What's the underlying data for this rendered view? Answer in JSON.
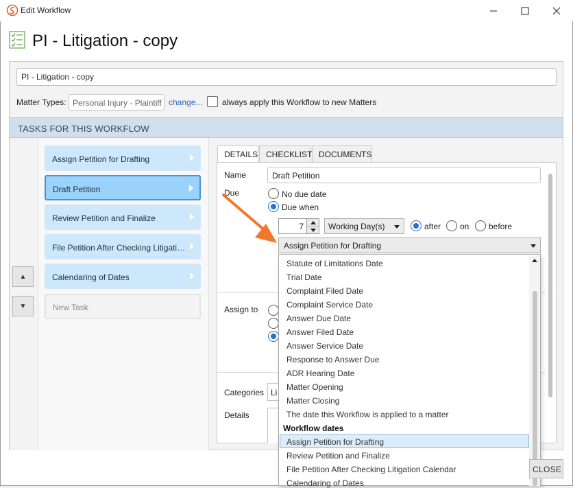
{
  "window": {
    "title": "Edit Workflow"
  },
  "header": {
    "title": "PI - Litigation - copy"
  },
  "form": {
    "workflow_name": "PI - Litigation - copy",
    "matter_types_label": "Matter Types:",
    "matter_types_value": "Personal Injury - Plaintiff",
    "change_link": "change...",
    "always_apply_label": "always apply this Workflow to new Matters"
  },
  "tasks_section": {
    "header": "TASKS FOR THIS WORKFLOW",
    "tasks": [
      {
        "label": "Assign Petition for Drafting"
      },
      {
        "label": "Draft Petition"
      },
      {
        "label": "Review Petition and Finalize"
      },
      {
        "label": "File Petition After Checking Litigation Calendar"
      },
      {
        "label": "Calendaring of Dates"
      }
    ],
    "new_task_label": "New Task",
    "selected_index": 1
  },
  "tabs": [
    {
      "label": "DETAILS"
    },
    {
      "label": "CHECKLIST"
    },
    {
      "label": "DOCUMENTS"
    }
  ],
  "details": {
    "name_label": "Name",
    "name_value": "Draft Petition",
    "due_label": "Due",
    "no_due_date": "No due date",
    "due_when": "Due when",
    "amount": "7",
    "unit": "Working Day(s)",
    "after": "after",
    "on": "on",
    "before": "before",
    "reference": "Assign Petition for Drafting",
    "assign_to_label": "Assign to",
    "categories_label": "Categories",
    "categories_value": "Li",
    "details_label": "Details"
  },
  "dropdown": {
    "items": [
      "Statute of Limitations Date",
      "Trial Date",
      "Complaint Filed Date",
      "Complaint Service Date",
      "Answer Due Date",
      "Answer Filed Date",
      "Answer Service Date",
      "Response to Answer Due",
      "ADR Hearing Date",
      "Matter Opening",
      "Matter Closing",
      "The date this Workflow is applied to a matter"
    ],
    "group_header": "Workflow dates",
    "workflow_items": [
      "Assign Petition for Drafting",
      "Review Petition and Finalize",
      "File Petition After Checking Litigation Calendar",
      "Calendaring of Dates"
    ]
  },
  "footer": {
    "close_label": "CLOSE"
  },
  "colors": {
    "accent": "#2a6fce",
    "task_bg": "#cde8fb",
    "task_selected_bg": "#9bd2fb",
    "annotation_arrow": "#f0782a"
  }
}
